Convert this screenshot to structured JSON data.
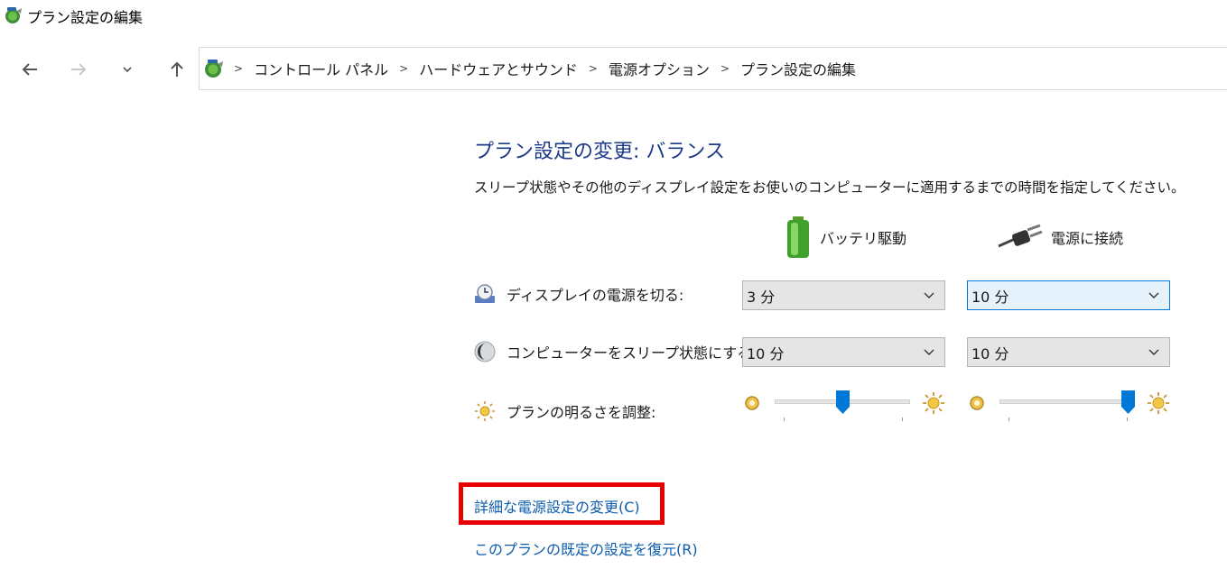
{
  "window": {
    "title": "プラン設定の編集",
    "icon": "power-options-app-icon"
  },
  "nav": {
    "back_icon": "arrow-left-icon",
    "forward_icon": "arrow-right-icon",
    "recent_icon": "chevron-down-icon",
    "up_icon": "arrow-up-icon"
  },
  "breadcrumb": {
    "items": [
      "コントロール パネル",
      "ハードウェアとサウンド",
      "電源オプション",
      "プラン設定の編集"
    ],
    "separator": ">"
  },
  "main": {
    "heading": "プラン設定の変更: バランス",
    "description": "スリープ状態やその他のディスプレイ設定をお使いのコンピューターに適用するまでの時間を指定してください。",
    "columns": {
      "battery": "バッテリ駆動",
      "plugged": "電源に接続"
    },
    "rows": {
      "display": {
        "label": "ディスプレイの電源を切る:",
        "battery_value": "3 分",
        "plugged_value": "10 分"
      },
      "sleep": {
        "label": "コンピューターをスリープ状態にする:",
        "battery_value": "10 分",
        "plugged_value": "10 分"
      },
      "brightness": {
        "label": "プランの明るさを調整:",
        "battery_percent": 50,
        "plugged_percent": 100
      }
    },
    "links": {
      "advanced": "詳細な電源設定の変更(C)",
      "restore": "このプランの既定の設定を復元(R)"
    }
  },
  "colors": {
    "heading": "#1e3a8a",
    "link": "#0b5cad",
    "highlight": "#e60000",
    "slider_thumb": "#0078d7"
  }
}
